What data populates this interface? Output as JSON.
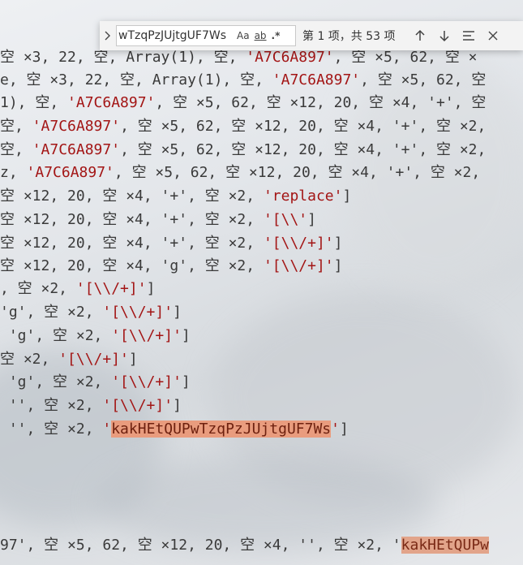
{
  "find_widget": {
    "toggle_icon": "chevron-right-icon",
    "query": "wTzqPzJUjtgUF7Ws",
    "opt_case": "Aa",
    "opt_word": "ab",
    "opt_regex": ".*",
    "result_count": "第 1 项，共 53 项",
    "prev_icon": "arrow-up-icon",
    "next_icon": "arrow-down-icon",
    "menu_icon": "menu-icon",
    "close_icon": "close-icon"
  },
  "code_lines": [
    {
      "left": "空 ×3, 22, 空, Array(1), 空, ",
      "str": "'A7C6A897'",
      "right": ", 空 ×5, 62, 空 ×"
    },
    {
      "left": "e, 空 ×3, 22, 空, Array(1), 空, ",
      "str": "'A7C6A897'",
      "right": ", 空 ×5, 62, 空"
    },
    {
      "left": "1), 空, ",
      "str": "'A7C6A897'",
      "right": ", 空 ×5, 62, 空 ×12, 20, 空 ×4, '+', 空"
    },
    {
      "left": "空, ",
      "str": "'A7C6A897'",
      "right": ", 空 ×5, 62, 空 ×12, 20, 空 ×4, '+', 空 ×2,"
    },
    {
      "left": "空, ",
      "str": "'A7C6A897'",
      "right": ", 空 ×5, 62, 空 ×12, 20, 空 ×4, '+', 空 ×2,"
    },
    {
      "left": "z, ",
      "str": "'A7C6A897'",
      "right": ", 空 ×5, 62, 空 ×12, 20, 空 ×4, '+', 空 ×2,"
    },
    {
      "left": "空 ×12, 20, 空 ×4, '+', 空 ×2, ",
      "str": "'replace'",
      "right": "]"
    },
    {
      "left": "空 ×12, 20, 空 ×4, '+', 空 ×2, ",
      "str": "'[\\\\'",
      "right": "]"
    },
    {
      "left": "空 ×12, 20, 空 ×4, '+', 空 ×2, ",
      "str": "'[\\\\/+]'",
      "right": "]"
    },
    {
      "left": "空 ×12, 20, 空 ×4, 'g', 空 ×2, ",
      "str": "'[\\\\/+]'",
      "right": "]"
    },
    {
      "left": ", 空 ×2, ",
      "str": "'[\\\\/+]'",
      "right": "]"
    },
    {
      "left": "'g', 空 ×2, ",
      "str": "'[\\\\/+]'",
      "right": "]"
    },
    {
      "left": " 'g', 空 ×2, ",
      "str": "'[\\\\/+]'",
      "right": "]"
    },
    {
      "left": "空 ×2, ",
      "str": "'[\\\\/+]'",
      "right": "]"
    },
    {
      "left": " 'g', 空 ×2, ",
      "str": "'[\\\\/+]'",
      "right": "]"
    },
    {
      "left": " '', 空 ×2, ",
      "str": "'[\\\\/+]'",
      "right": "]"
    },
    {
      "left": " '', 空 ×2, ",
      "str_pre": "'",
      "match": "kakHEtQUPwTzqPzJUjtgUF7Ws",
      "str_post": "'",
      "right": "]"
    },
    {
      "left": "97', 空 ×5, 62, 空 ×12, 20, 空 ×4, '', 空 ×2, '",
      "match": "kakHEtQUPw",
      "right": ""
    }
  ]
}
